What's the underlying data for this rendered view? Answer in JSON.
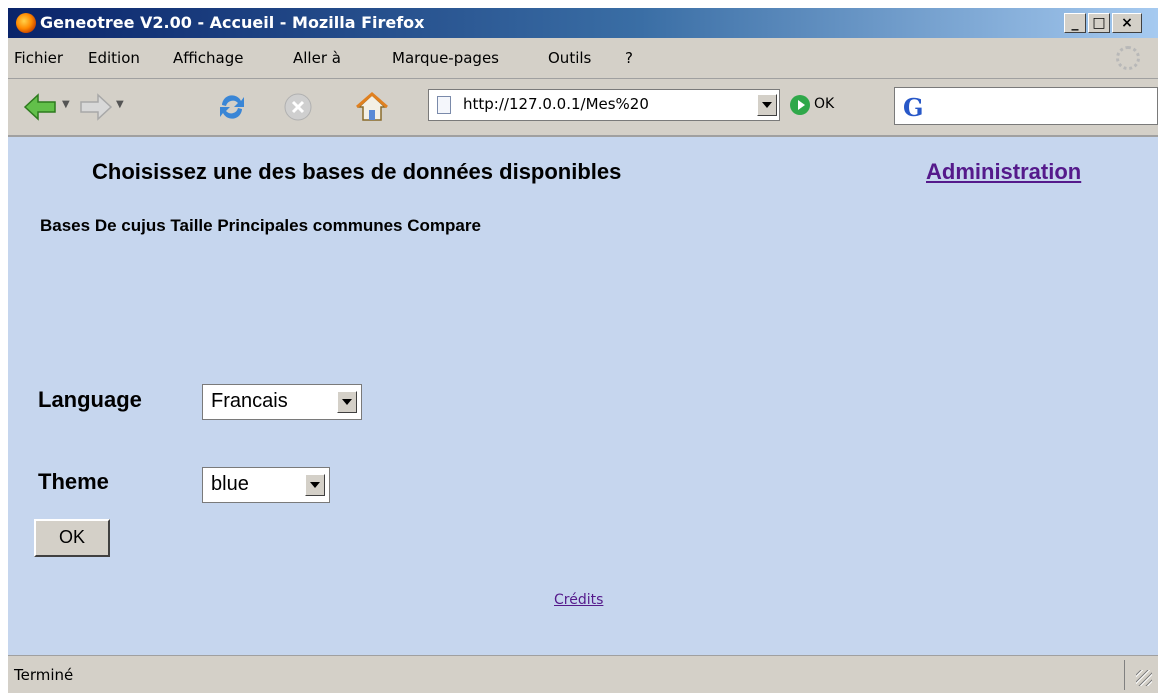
{
  "window": {
    "title": "Geneotree V2.00 - Accueil - Mozilla Firefox",
    "minimize": "_",
    "maximize": "□",
    "close": "×"
  },
  "menu": {
    "items": [
      "Fichier",
      "Edition",
      "Affichage",
      "Aller à",
      "Marque-pages",
      "Outils",
      "?"
    ]
  },
  "toolbar": {
    "url": "http://127.0.0.1/Mes%20",
    "go_label": "OK"
  },
  "page": {
    "heading": "Choisissez une des bases de données disponibles",
    "admin_link": "Administration",
    "columns_header": "Bases De cujus Taille Principales communes Compare",
    "language_label": "Language",
    "language_value": "Francais",
    "theme_label": "Theme",
    "theme_value": "blue",
    "ok_button": "OK",
    "credits_link": "Crédits"
  },
  "status": {
    "text": "Terminé"
  },
  "colors": {
    "page_background": "#c6d6ee",
    "link_visited": "#551a8b",
    "titlebar_start": "#0a246a",
    "titlebar_end": "#a6caf0"
  },
  "icons": {
    "back": "back-arrow-icon",
    "forward": "forward-arrow-icon",
    "reload": "reload-icon",
    "stop": "stop-icon",
    "home": "home-icon",
    "go": "go-icon",
    "search_engine": "google-icon"
  }
}
